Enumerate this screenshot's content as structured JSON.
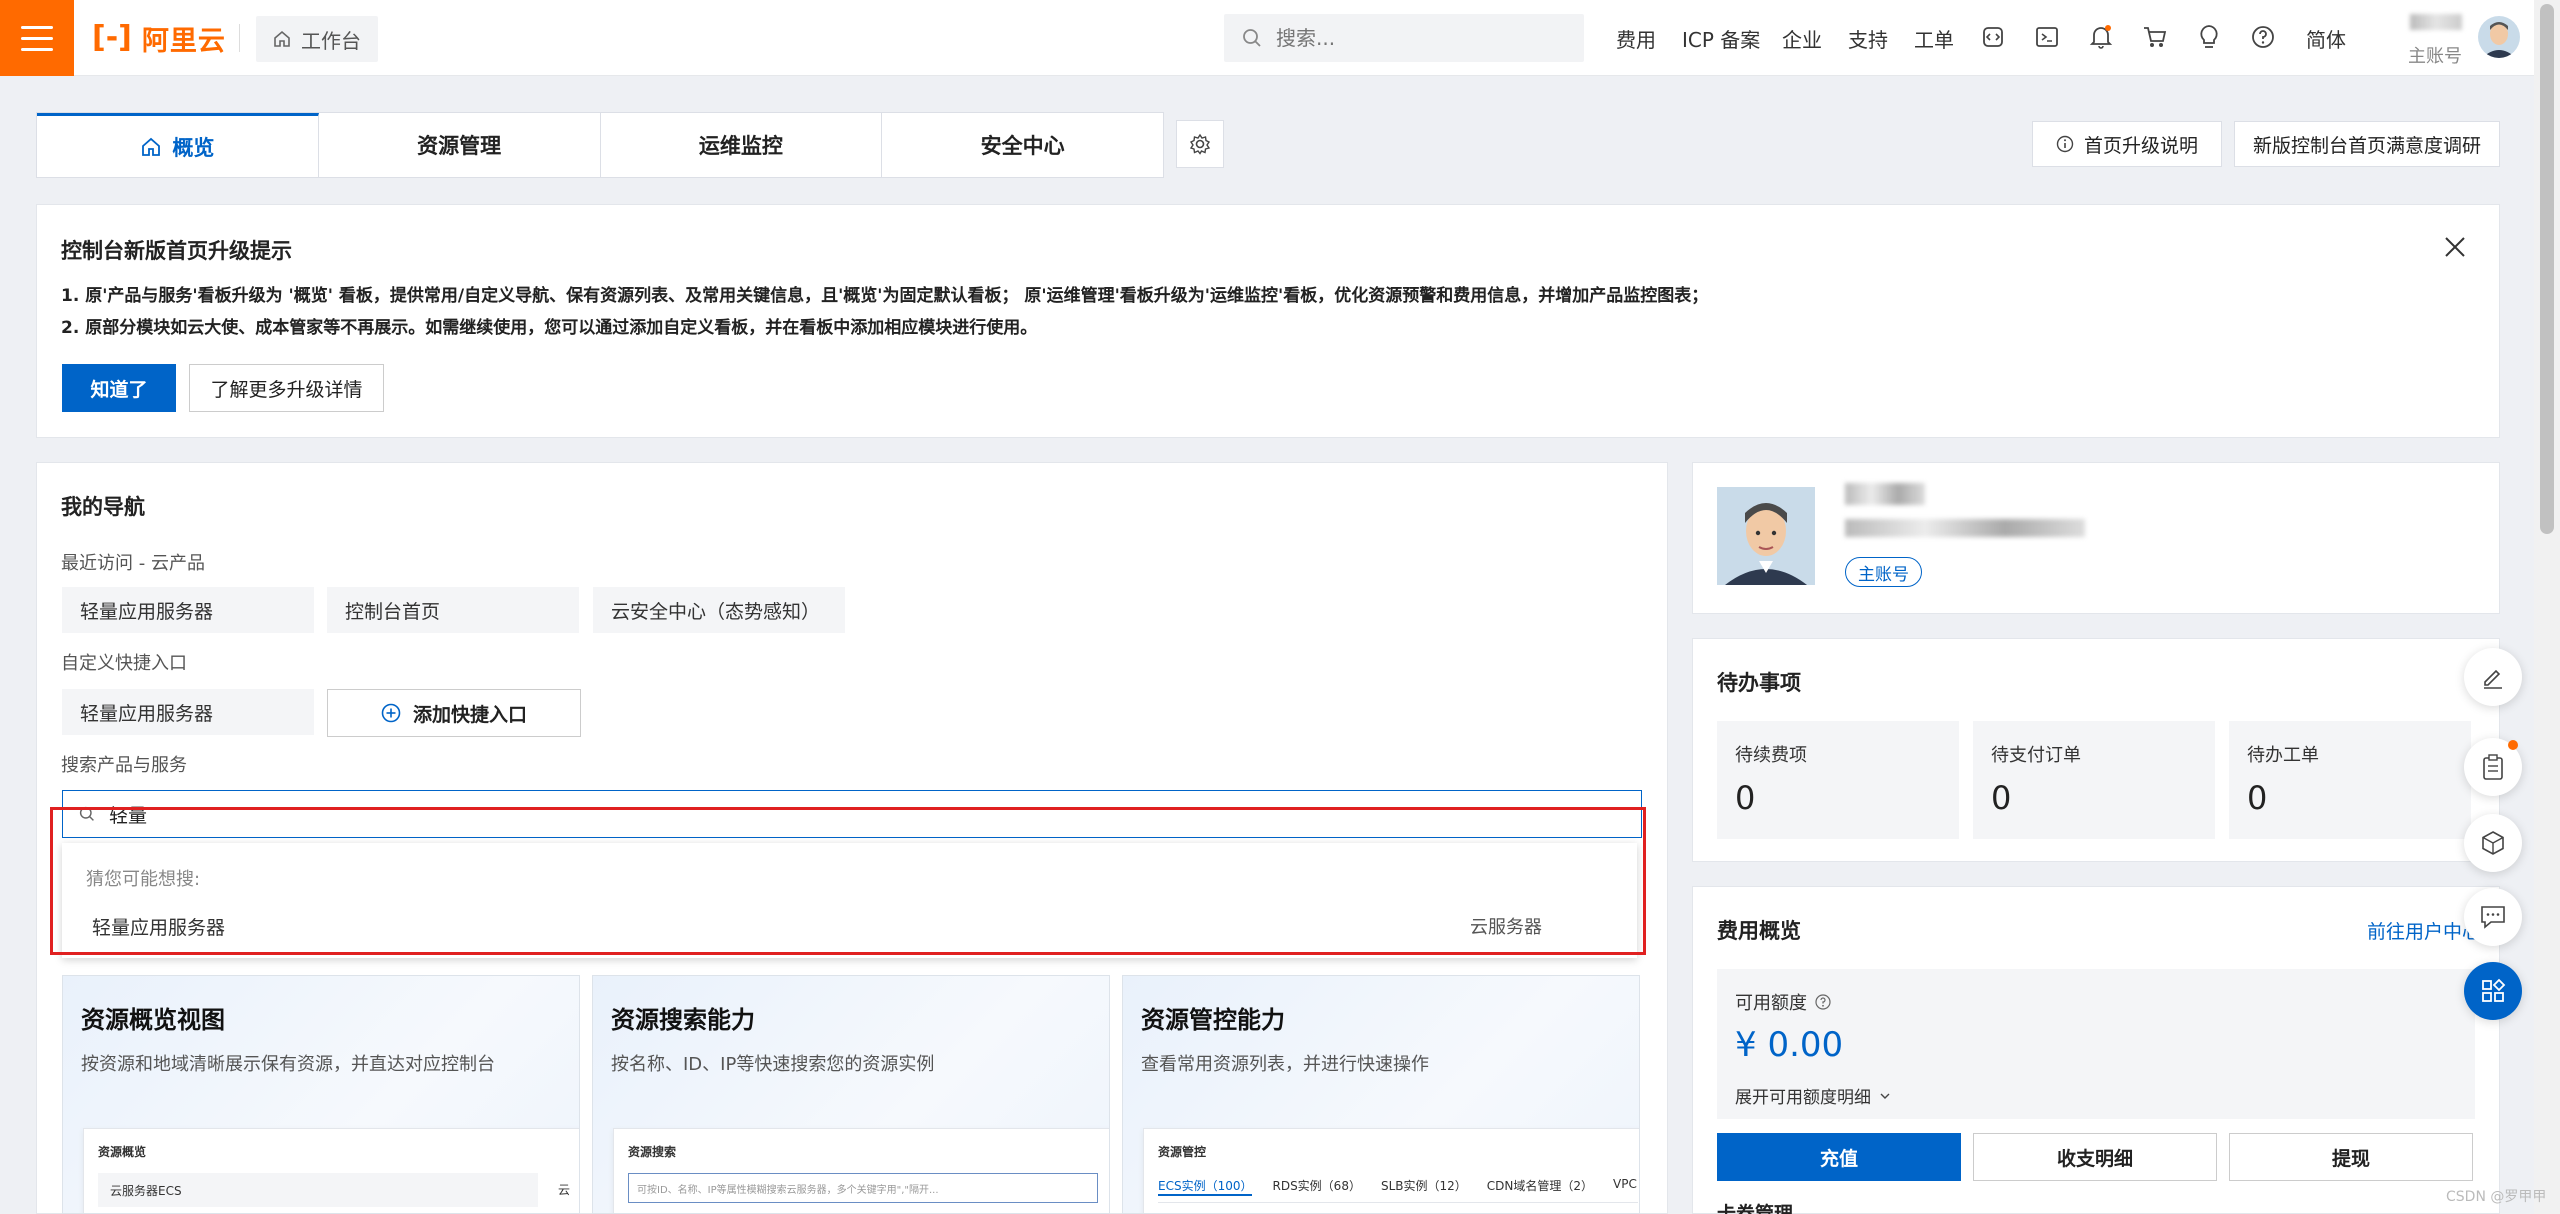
{
  "topbar": {
    "logo_text": "阿里云",
    "workbench": "工作台",
    "search_placeholder": "搜索...",
    "links": [
      "费用",
      "ICP 备案",
      "企业",
      "支持",
      "工单"
    ],
    "lang": "简体",
    "account_label": "主账号"
  },
  "tabs": [
    {
      "label": "概览",
      "active": true
    },
    {
      "label": "资源管理",
      "active": false
    },
    {
      "label": "运维监控",
      "active": false
    },
    {
      "label": "安全中心",
      "active": false
    }
  ],
  "header_buttons": {
    "upgrade_note": "首页升级说明",
    "survey": "新版控制台首页满意度调研"
  },
  "notice": {
    "title": "控制台新版首页升级提示",
    "line1": "1. 原'产品与服务'看板升级为 '概览' 看板，提供常用/自定义导航、保有资源列表、及常用关键信息，且'概览'为固定默认看板； 原'运维管理'看板升级为'运维监控'看板，优化资源预警和费用信息，并增加产品监控图表；",
    "line2": "2. 原部分模块如云大使、成本管家等不再展示。如需继续使用，您可以通过添加自定义看板，并在看板中添加相应模块进行使用。",
    "ok": "知道了",
    "more": "了解更多升级详情"
  },
  "mynav": {
    "title": "我的导航",
    "recent_label": "最近访问 - 云产品",
    "recent": [
      "轻量应用服务器",
      "控制台首页",
      "云安全中心（态势感知）"
    ],
    "custom_label": "自定义快捷入口",
    "custom": [
      "轻量应用服务器"
    ],
    "add_shortcut": "添加快捷入口",
    "search_label": "搜索产品与服务",
    "search_value": "轻量",
    "suggest_hint": "猜您可能想搜:",
    "suggest_item": "轻量应用服务器",
    "suggest_category": "云服务器"
  },
  "cards": [
    {
      "title": "资源概览视图",
      "desc": "按资源和地域清晰展示保有资源，并直达对应控制台",
      "inner_title": "资源概览",
      "inner_row": "云服务器ECS",
      "inner_extra": "云"
    },
    {
      "title": "资源搜索能力",
      "desc": "按名称、ID、IP等快速搜索您的资源实例",
      "inner_title": "资源搜索",
      "inner_placeholder": "可按ID、名称、IP等属性模糊搜索云服务器，多个关键字用\",\"隔开..."
    },
    {
      "title": "资源管控能力",
      "desc": "查看常用资源列表，并进行快速操作",
      "inner_title": "资源管控",
      "inner_tabs": [
        "ECS实例（100）",
        "RDS实例（68）",
        "SLB实例（12）",
        "CDN域名管理（2）",
        "VPC"
      ]
    }
  ],
  "profile": {
    "badge": "主账号"
  },
  "todo": {
    "title": "待办事项",
    "items": [
      {
        "label": "待续费项",
        "value": "0"
      },
      {
        "label": "待支付订单",
        "value": "0"
      },
      {
        "label": "待办工单",
        "value": "0"
      }
    ]
  },
  "fee": {
    "title": "费用概览",
    "link": "前往用户中心",
    "credit_label": "可用额度",
    "credit_value": "¥ 0.00",
    "expand": "展开可用额度明细",
    "recharge": "充值",
    "detail": "收支明细",
    "withdraw": "提现",
    "card_mgmt": "卡券管理"
  },
  "watermark": "CSDN @罗甲甲",
  "colors": {
    "brand": "#ff6a00",
    "primary": "#0064c8",
    "highlight": "#e02020"
  }
}
